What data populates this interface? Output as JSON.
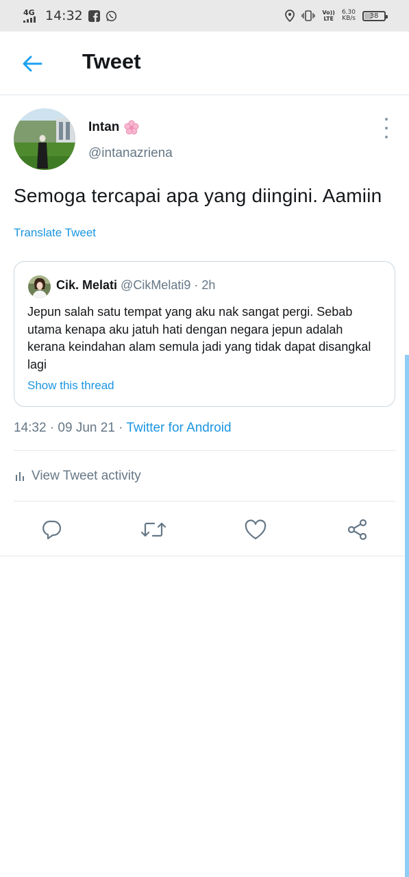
{
  "status_bar": {
    "network_top": "4G",
    "time": "14:32",
    "volte_top": "Vo))",
    "volte_bottom": "LTE",
    "speed_value": "6.30",
    "speed_unit": "KB/s",
    "battery": "38",
    "battery_level_fraction": 0.38,
    "icons": [
      "signal-icon",
      "facebook-icon",
      "whatsapp-icon",
      "location-icon",
      "vibrate-icon",
      "battery-icon"
    ]
  },
  "header": {
    "title": "Tweet",
    "back_icon": "back-arrow-icon"
  },
  "tweet": {
    "author_name": "Intan",
    "author_emoji": "🌸",
    "author_handle": "@intanazriena",
    "text": "Semoga tercapai apa yang diingini. Aamiin",
    "translate_label": "Translate Tweet",
    "time_date": "14:32 · 09 Jun 21 · ",
    "source": "Twitter for Android",
    "activity_label": "View Tweet activity"
  },
  "quoted": {
    "name": "Cik. Melati",
    "handle": "@CikMelati9",
    "time": "· 2h",
    "text": "Jepun salah satu tempat yang aku nak sangat pergi. Sebab utama kenapa aku jatuh hati dengan negara jepun adalah kerana keindahan alam semula jadi yang tidak dapat disangkal lagi",
    "thread_label": "Show this thread"
  },
  "actions": [
    "reply-icon",
    "retweet-icon",
    "like-icon",
    "share-icon"
  ],
  "colors": {
    "accent": "#1da1f2",
    "link": "#1b95e0",
    "muted": "#657786",
    "text": "#14171a",
    "border": "#e1e8ed",
    "statusbar": "#e9e9e9"
  }
}
